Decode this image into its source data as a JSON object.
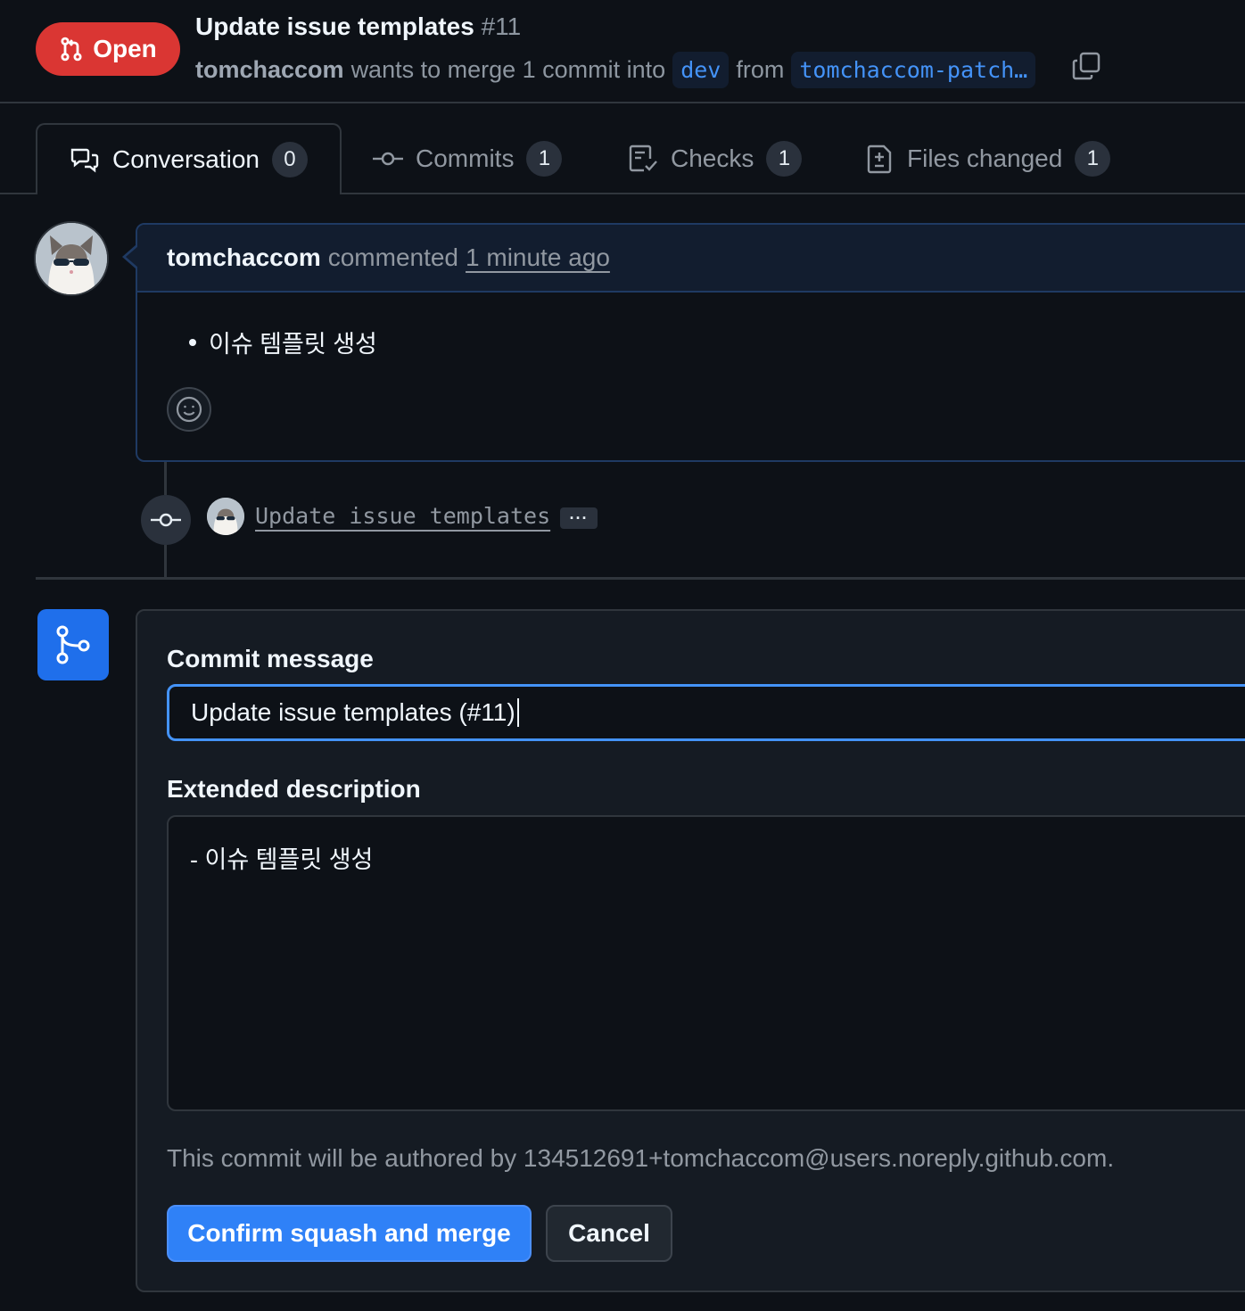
{
  "header": {
    "status_label": "Open",
    "title": "Update issue templates",
    "number": "#11",
    "author": "tomchaccom",
    "merge_text_pre": "wants to merge 1 commit into",
    "base_branch": "dev",
    "merge_text_from": "from",
    "head_branch": "tomchaccom-patch…"
  },
  "tabs": [
    {
      "label": "Conversation",
      "count": "0",
      "icon": "comment-discussion-icon"
    },
    {
      "label": "Commits",
      "count": "1",
      "icon": "git-commit-icon"
    },
    {
      "label": "Checks",
      "count": "1",
      "icon": "checklist-icon"
    },
    {
      "label": "Files changed",
      "count": "1",
      "icon": "file-diff-icon"
    }
  ],
  "comment": {
    "author": "tomchaccom",
    "action": "commented",
    "time": "1 minute ago",
    "body_item": "이슈 템플릿 생성"
  },
  "commit": {
    "message": "Update issue templates",
    "more": "···"
  },
  "merge_form": {
    "commit_message_label": "Commit message",
    "commit_message_value": "Update issue templates (#11)",
    "extended_label": "Extended description",
    "extended_value": "- 이슈 템플릿 생성",
    "author_note": "This commit will be authored by 134512691+tomchaccom@users.noreply.github.com.",
    "confirm_label": "Confirm squash and merge",
    "cancel_label": "Cancel"
  },
  "colors": {
    "background": "#0d1117",
    "open_badge": "#da3633",
    "accent": "#4493f8",
    "confirm_button": "#2f81f7"
  }
}
